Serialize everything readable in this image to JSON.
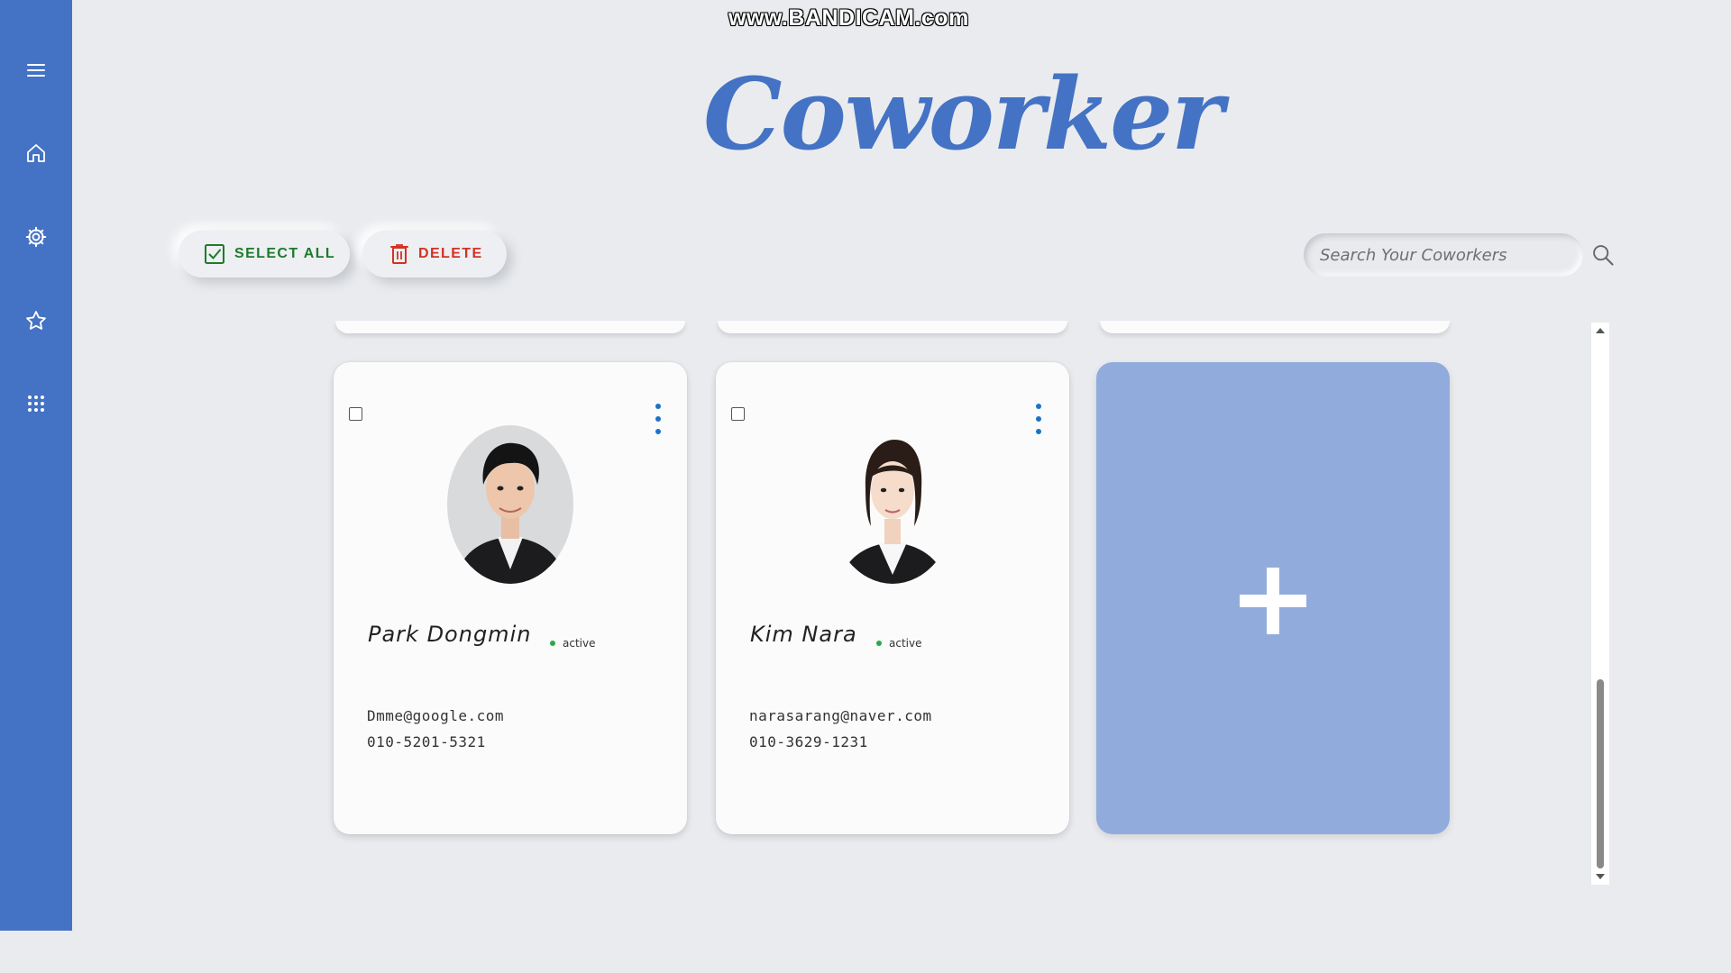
{
  "watermark": "www.BANDICAM.com",
  "app": {
    "title": "Coworker"
  },
  "sidebar": {
    "items": [
      {
        "icon": "menu-icon"
      },
      {
        "icon": "home-icon"
      },
      {
        "icon": "settings-icon"
      },
      {
        "icon": "star-icon"
      },
      {
        "icon": "apps-grid-icon"
      }
    ]
  },
  "toolbar": {
    "select_all_label": "SELECT ALL",
    "delete_label": "DELETE",
    "search_placeholder": "Search Your Coworkers"
  },
  "cards": [
    {
      "name": "Park Dongmin",
      "status": "active",
      "email": "Dmme@google.com",
      "phone": "010-5201-5321"
    },
    {
      "name": "Kim Nara",
      "status": "active",
      "email": "narasarang@naver.com",
      "phone": "010-3629-1231"
    }
  ],
  "add_card": {
    "icon": "plus-icon"
  },
  "colors": {
    "accent": "#4472c4",
    "add_card": "#91acdc",
    "select_all": "#1e7a2c",
    "delete": "#d23224",
    "status_active": "#2aa84a",
    "menu_dots": "#1a73c8",
    "background": "#e9ebee"
  }
}
